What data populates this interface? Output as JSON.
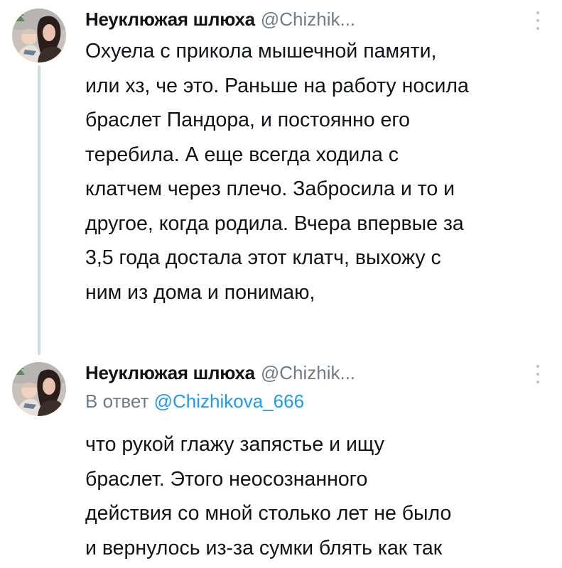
{
  "tweets": [
    {
      "author_name": "Неуклюжая шлюха",
      "author_handle": "@Chizhik...",
      "text": "Охуела с прикола мышечной памяти,\nили хз, че это. Раньше на работу носила\nбраслет Пандора, и постоянно его\nтеребила. А еще всегда ходила с\nклатчем через плечо. Забросила и то и\nдругое, когда родила. Вчера впервые за\n3,5 года достала этот клатч, выхожу с\nним из дома и понимаю,"
    },
    {
      "author_name": "Неуклюжая шлюха",
      "author_handle": "@Chizhik...",
      "reply_prefix": "В ответ",
      "reply_mention": "@Chizhikova_666",
      "text": "что рукой глажу запястье и ищу\nбраслет. Этого неосознанного\nдействия со мной столько лет не было\nи вернулось из-за сумки блять как так"
    }
  ],
  "icons": {
    "avatar": "avatar-photo",
    "more": "more-vertical-icon"
  },
  "colors": {
    "text": "#0f1419",
    "secondary": "#6f7c88",
    "link": "#1d9bf0",
    "thread_line": "#cfd9de"
  }
}
